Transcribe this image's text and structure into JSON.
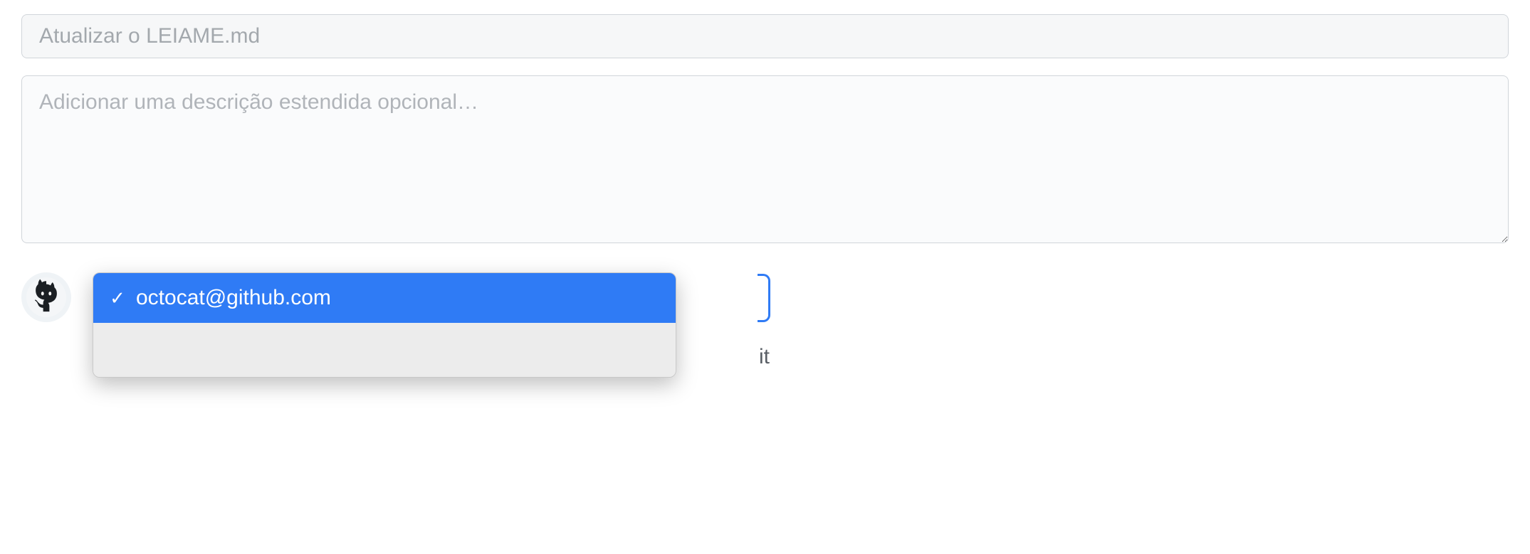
{
  "commit": {
    "summary_placeholder": "Atualizar o LEIAME.md",
    "description_placeholder": "Adicionar uma descrição estendida opcional…"
  },
  "author_dropdown": {
    "options": [
      {
        "email": "octocat@github.com",
        "selected": true
      }
    ]
  },
  "obscured_text": "it"
}
